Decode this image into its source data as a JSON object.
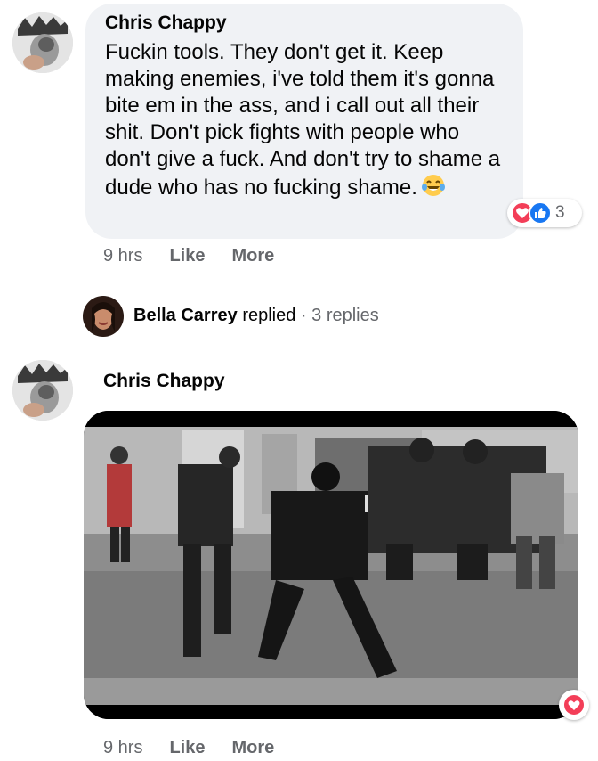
{
  "comments": [
    {
      "author": "Chris Chappy",
      "text": "Fuckin tools. They don't get it. Keep making enemies, i've told them it's gonna bite em in the ass, and i call out all their shit. Don't pick fights with people who don't give a fuck. And don't try to shame a dude who has no fucking shame.",
      "emoji": "laughing-tears-emoji",
      "reactions": {
        "icons": [
          "heart-icon",
          "like-icon"
        ],
        "count": "3"
      },
      "time": "9 hrs",
      "like_label": "Like",
      "more_label": "More"
    },
    {
      "author": "Chris Chappy",
      "attachment": "video-thumbnail",
      "reactions": {
        "icons": [
          "heart-icon"
        ]
      },
      "time": "9 hrs",
      "like_label": "Like",
      "more_label": "More"
    }
  ],
  "replies": {
    "name": "Bella Carrey",
    "verb": "replied",
    "separator": "·",
    "count_label": "3 replies"
  },
  "colors": {
    "bubble": "#f0f2f5",
    "heart": "#f33e58",
    "like": "#1877f2",
    "meta_text": "#65676b"
  }
}
